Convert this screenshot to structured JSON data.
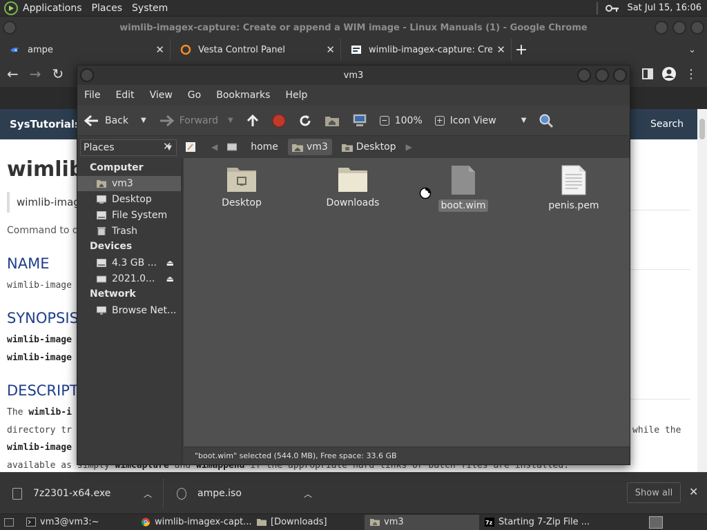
{
  "top_panel": {
    "menus": [
      "Applications",
      "Places",
      "System"
    ],
    "clock": "Sat Jul 15, 16:06"
  },
  "chrome": {
    "window_title": "wimlib-imagex-capture: Create or append a WIM image - Linux Manuals (1) - Google Chrome",
    "tabs": [
      {
        "title": "ampe",
        "icon": "blue-swoosh-icon"
      },
      {
        "title": "Vesta Control Panel",
        "icon": "vesta-ring-icon"
      },
      {
        "title": "wimlib-imagex-capture: Creat",
        "icon": "systutorials-icon"
      }
    ],
    "new_tab": "+"
  },
  "webpage": {
    "brand": "SysTutorials",
    "search_label": "Search",
    "heading": "wimlib",
    "subtitle_box": "wimlib-image",
    "intro": "Command to di",
    "name_heading": "NAME",
    "name_text": "wimlib-image",
    "synopsis_heading": "SYNOPSIS",
    "synopsis_1": "wimlib-image",
    "synopsis_2": "wimlib-image",
    "description_heading": "DESCRIPT",
    "desc_line1_start": "The",
    "desc_line1_bold": "wimlib-i",
    "desc_line1_end": "a",
    "desc_line2_start": "directory tr",
    "desc_line2_end": "while the",
    "desc_line3_bold": "wimlib-image",
    "desc_line4_start": "available as",
    "desc_line4_mid1": "simply",
    "desc_line4_b1": "wimcapture",
    "desc_line4_mid2": "and",
    "desc_line4_b2": "wimappend",
    "desc_line4_end": "if the appropriate hard links or batch files are installed."
  },
  "downloads": {
    "items": [
      {
        "name": "7z2301-x64.exe"
      },
      {
        "name": "ampe.iso"
      }
    ],
    "show_all": "Show all"
  },
  "taskbar": {
    "items": [
      {
        "label": "vm3@vm3:~",
        "icon": "terminal-icon"
      },
      {
        "label": "wimlib-imagex-capt...",
        "icon": "chrome-icon"
      },
      {
        "label": "[Downloads]",
        "icon": "folder-icon"
      },
      {
        "label": "vm3",
        "icon": "home-folder-icon",
        "active": true
      },
      {
        "label": "Starting 7-Zip File ...",
        "icon": "7zip-icon"
      }
    ]
  },
  "file_manager": {
    "title": "vm3",
    "menu": [
      "File",
      "Edit",
      "View",
      "Go",
      "Bookmarks",
      "Help"
    ],
    "toolbar": {
      "back": "Back",
      "forward": "Forward",
      "zoom": "100%",
      "view_mode": "Icon View"
    },
    "places_label": "Places",
    "breadcrumbs": [
      "home",
      "vm3",
      "Desktop"
    ],
    "sidebar": {
      "computer_heading": "Computer",
      "computer_items": [
        "vm3",
        "Desktop",
        "File System",
        "Trash"
      ],
      "devices_heading": "Devices",
      "devices_items": [
        "4.3 GB ...",
        "2021.0..."
      ],
      "network_heading": "Network",
      "network_items": [
        "Browse Net..."
      ]
    },
    "files": [
      {
        "name": "Desktop",
        "type": "folder-desktop"
      },
      {
        "name": "Downloads",
        "type": "folder-downloads"
      },
      {
        "name": "boot.wim",
        "type": "file-generic",
        "selected": true
      },
      {
        "name": "penis.pem",
        "type": "file-text"
      }
    ],
    "status": "\"boot.wim\" selected (544.0 MB), Free space: 33.6 GB"
  }
}
